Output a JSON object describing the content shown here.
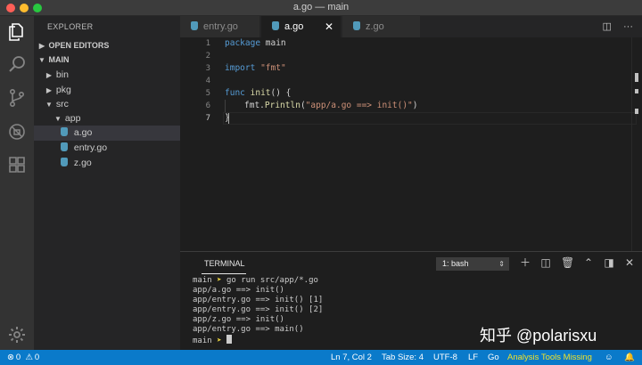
{
  "window": {
    "title": "a.go — main"
  },
  "explorer": {
    "title": "EXPLORER",
    "sections": {
      "open_editors": "OPEN EDITORS",
      "root": "MAIN"
    },
    "tree": {
      "bin": "bin",
      "pkg": "pkg",
      "src": "src",
      "app": "app",
      "a_go": "a.go",
      "entry_go": "entry.go",
      "z_go": "z.go"
    }
  },
  "tabs": [
    {
      "label": "entry.go",
      "active": false
    },
    {
      "label": "a.go",
      "active": true
    },
    {
      "label": "z.go",
      "active": false
    }
  ],
  "editor": {
    "line_numbers": [
      "1",
      "2",
      "3",
      "4",
      "5",
      "6",
      "7"
    ],
    "lines": {
      "l1_kw": "package",
      "l1_rest": " main",
      "l3_kw": "import",
      "l3_str": "\"fmt\"",
      "l5_kw": "func",
      "l5_fn": "init",
      "l5_rest": "() {",
      "l6_pkg": "fmt.",
      "l6_fn": "Println",
      "l6_open": "(",
      "l6_str": "\"app/a.go ==> init()\"",
      "l6_close": ")",
      "l7": "}"
    },
    "cursor_line": 7
  },
  "panel": {
    "title": "TERMINAL",
    "terminal_select": "1: bash",
    "lines": {
      "cmd_prompt": "main",
      "cmd_arrow": "➤",
      "cmd_text": " go run src/app/*.go",
      "out1": "app/a.go ==> init()",
      "out2": "app/entry.go ==> init() [1]",
      "out3": "app/entry.go ==> init() [2]",
      "out4": "app/z.go ==> init()",
      "out5": "app/entry.go ==> main()",
      "final_prompt": "main",
      "final_arrow": "➤"
    }
  },
  "watermark": "知乎 @polarisxu",
  "statusbar": {
    "errors": "0",
    "warnings": "0",
    "position": "Ln 7, Col 2",
    "tab_size": "Tab Size: 4",
    "encoding": "UTF-8",
    "eol": "LF",
    "language": "Go",
    "analysis": "Analysis Tools Missing"
  },
  "colors": {
    "statusbar": "#0a7aca",
    "go_file_icon": "#519aba",
    "keyword": "#569cd6",
    "string": "#ce9178",
    "function": "#dcdcaa",
    "warning_text": "#f0e12a"
  }
}
